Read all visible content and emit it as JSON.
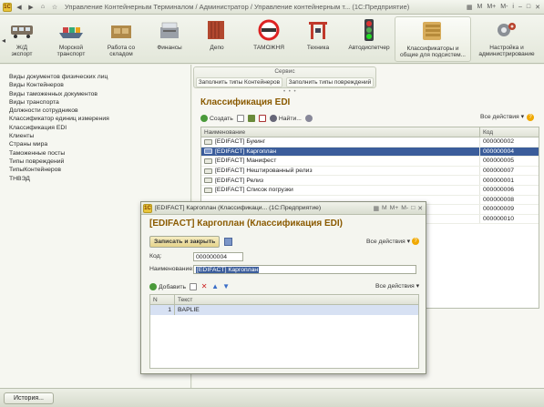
{
  "window": {
    "title": "Управление Контейнерным Терминалом / Администратор / Управление контейнерным т... (1С:Предприятие)",
    "logo": "1С",
    "controls": [
      "M",
      "M+",
      "M-",
      "i"
    ]
  },
  "sections": [
    {
      "label": "Ж/Д\nэкспорт",
      "icon": "railway-icon"
    },
    {
      "label": "Морской\nтранспорт",
      "icon": "ship-icon"
    },
    {
      "label": "Работа со\nскладом",
      "icon": "warehouse-icon"
    },
    {
      "label": "Финансы",
      "icon": "cash-register-icon"
    },
    {
      "label": "Депо",
      "icon": "container-icon"
    },
    {
      "label": "ТАМОЖНЯ",
      "icon": "customs-sign-icon"
    },
    {
      "label": "Техника",
      "icon": "crane-icon"
    },
    {
      "label": "Автодиспетчер",
      "icon": "traffic-light-icon"
    },
    {
      "label": "Классификаторы и\nобщие для подсистем...",
      "icon": "folders-icon"
    },
    {
      "label": "Настройка и\nадминистрирование",
      "icon": "gears-icon"
    }
  ],
  "left_nav": [
    "Виды документов физических лиц",
    "Виды Контейнеров",
    "Виды таможенных документов",
    "Виды транспорта",
    "Должности сотрудников",
    "Классификатор единиц измерения",
    "Классификация EDI",
    "Клиенты",
    "Страны мира",
    "Таможенные посты",
    "Типы повреждений",
    "ТипыКонтейнеров",
    "ТНВЭД"
  ],
  "service": {
    "title": "Сервис",
    "link1": "Заполнить типы Контейнеров",
    "link2": "Заполнить типы повреждений"
  },
  "list": {
    "title": "Классификация EDI",
    "create": "Создать",
    "find": "Найти...",
    "all_actions": "Все действия",
    "columns": {
      "name": "Наименование",
      "code": "Код"
    },
    "rows": [
      {
        "name": "[EDIFACT] Букинг",
        "code": "000000002"
      },
      {
        "name": "[EDIFACT] Каргоплан",
        "code": "000000004"
      },
      {
        "name": "[EDIFACT] Манифест",
        "code": "000000005"
      },
      {
        "name": "[EDIFACT] Нештированный релиз",
        "code": "000000007"
      },
      {
        "name": "[EDIFACT] Релиз",
        "code": "000000001"
      },
      {
        "name": "[EDIFACT] Список погрузки",
        "code": "000000006"
      },
      {
        "name": "",
        "code": "000000008"
      },
      {
        "name": "",
        "code": "000000009"
      },
      {
        "name": "",
        "code": "000000010"
      }
    ],
    "selected_index": 1
  },
  "dialog": {
    "title": "[EDIFACT] Каргоплан (Классификаци...   (1С:Предприятие)",
    "heading": "[EDIFACT] Каргоплан (Классификация EDI)",
    "save_close": "Записать и закрыть",
    "all_actions": "Все действия",
    "code_label": "Код:",
    "code_value": "000000004",
    "name_label": "Наименование:",
    "name_value": "[EDIFACT] Каргоплан",
    "add": "Добавить",
    "sub_all_actions": "Все действия",
    "table_columns": {
      "n": "N",
      "text": "Текст"
    },
    "table_rows": [
      {
        "n": "1",
        "text": "BAPLIE"
      }
    ]
  },
  "status": {
    "history": "История..."
  }
}
